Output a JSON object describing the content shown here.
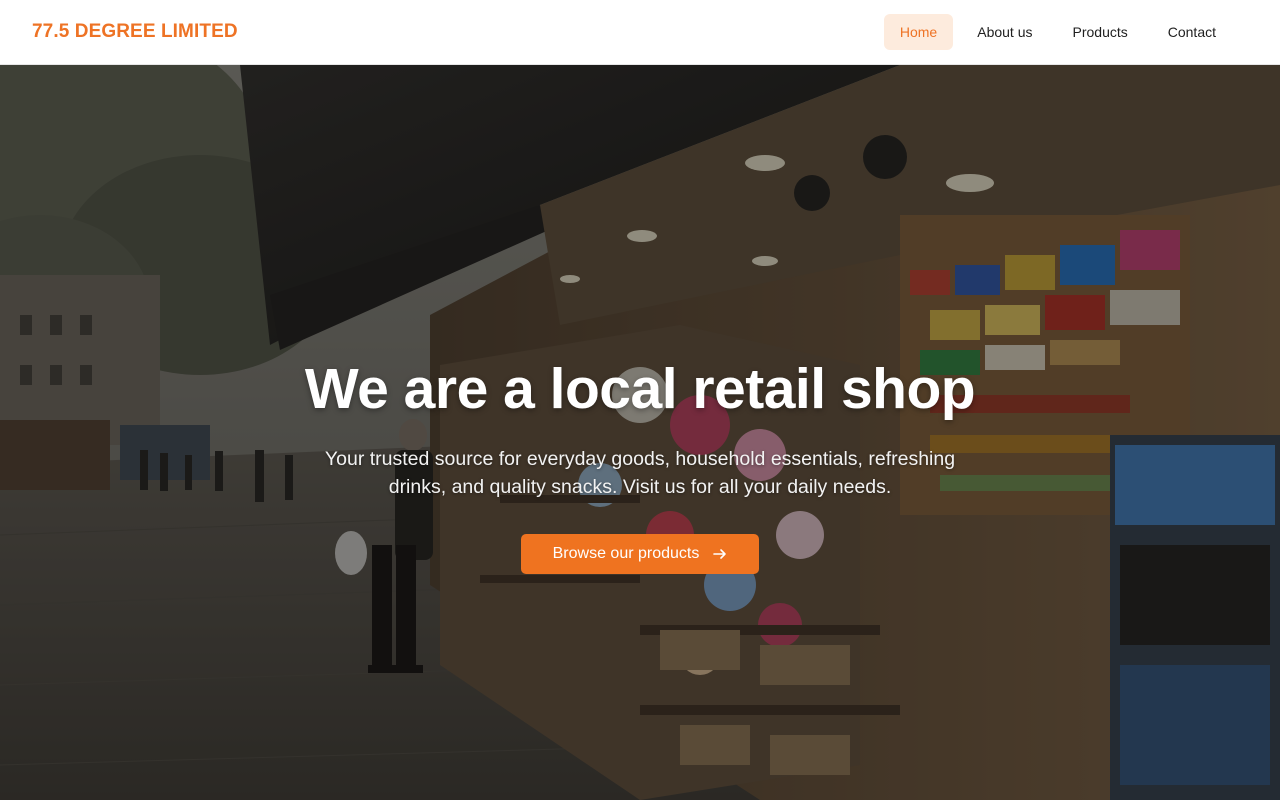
{
  "header": {
    "brand": "77.5 DEGREE LIMITED",
    "nav": [
      {
        "label": "Home",
        "active": true
      },
      {
        "label": "About us",
        "active": false
      },
      {
        "label": "Products",
        "active": false
      },
      {
        "label": "Contact",
        "active": false
      }
    ]
  },
  "hero": {
    "title": "We are a local retail shop",
    "subtitle": "Your trusted source for everyday goods, household essentials, refreshing drinks, and quality snacks. Visit us for all your daily needs.",
    "cta_label": "Browse our products",
    "cta_icon": "arrow-right-icon",
    "background_image": "street-kiosk-photo"
  },
  "colors": {
    "brand": "#ee7325",
    "nav_active_bg": "#fdebdd",
    "cta_bg": "#ef7320"
  }
}
